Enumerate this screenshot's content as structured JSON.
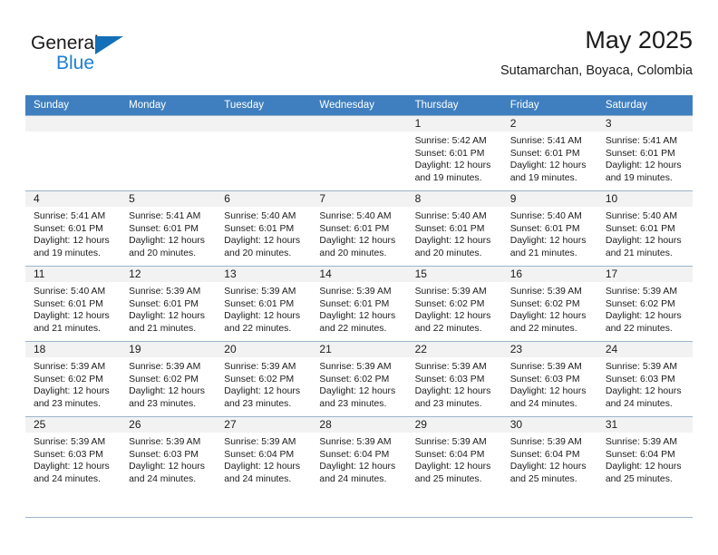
{
  "brand": {
    "name_part1": "General",
    "name_part2": "Blue",
    "color_primary": "#136fb7",
    "color_secondary": "#1b7fd4"
  },
  "header": {
    "title": "May 2025",
    "subtitle": "Sutamarchan, Boyaca, Colombia"
  },
  "calendar": {
    "header_bg": "#3f7fbf",
    "daynum_bg": "#f2f2f2",
    "grid_line": "#9cb4cc",
    "weekday_headers": [
      "Sunday",
      "Monday",
      "Tuesday",
      "Wednesday",
      "Thursday",
      "Friday",
      "Saturday"
    ],
    "labels": {
      "sunrise_prefix": "Sunrise:",
      "sunset_prefix": "Sunset:",
      "daylight_prefix": "Daylight:"
    },
    "weeks": [
      [
        {
          "empty": true
        },
        {
          "empty": true
        },
        {
          "empty": true
        },
        {
          "empty": true
        },
        {
          "day": "1",
          "sunrise": "Sunrise: 5:42 AM",
          "sunset": "Sunset: 6:01 PM",
          "daylight_line1": "Daylight: 12 hours",
          "daylight_line2": "and 19 minutes."
        },
        {
          "day": "2",
          "sunrise": "Sunrise: 5:41 AM",
          "sunset": "Sunset: 6:01 PM",
          "daylight_line1": "Daylight: 12 hours",
          "daylight_line2": "and 19 minutes."
        },
        {
          "day": "3",
          "sunrise": "Sunrise: 5:41 AM",
          "sunset": "Sunset: 6:01 PM",
          "daylight_line1": "Daylight: 12 hours",
          "daylight_line2": "and 19 minutes."
        }
      ],
      [
        {
          "day": "4",
          "sunrise": "Sunrise: 5:41 AM",
          "sunset": "Sunset: 6:01 PM",
          "daylight_line1": "Daylight: 12 hours",
          "daylight_line2": "and 19 minutes."
        },
        {
          "day": "5",
          "sunrise": "Sunrise: 5:41 AM",
          "sunset": "Sunset: 6:01 PM",
          "daylight_line1": "Daylight: 12 hours",
          "daylight_line2": "and 20 minutes."
        },
        {
          "day": "6",
          "sunrise": "Sunrise: 5:40 AM",
          "sunset": "Sunset: 6:01 PM",
          "daylight_line1": "Daylight: 12 hours",
          "daylight_line2": "and 20 minutes."
        },
        {
          "day": "7",
          "sunrise": "Sunrise: 5:40 AM",
          "sunset": "Sunset: 6:01 PM",
          "daylight_line1": "Daylight: 12 hours",
          "daylight_line2": "and 20 minutes."
        },
        {
          "day": "8",
          "sunrise": "Sunrise: 5:40 AM",
          "sunset": "Sunset: 6:01 PM",
          "daylight_line1": "Daylight: 12 hours",
          "daylight_line2": "and 20 minutes."
        },
        {
          "day": "9",
          "sunrise": "Sunrise: 5:40 AM",
          "sunset": "Sunset: 6:01 PM",
          "daylight_line1": "Daylight: 12 hours",
          "daylight_line2": "and 21 minutes."
        },
        {
          "day": "10",
          "sunrise": "Sunrise: 5:40 AM",
          "sunset": "Sunset: 6:01 PM",
          "daylight_line1": "Daylight: 12 hours",
          "daylight_line2": "and 21 minutes."
        }
      ],
      [
        {
          "day": "11",
          "sunrise": "Sunrise: 5:40 AM",
          "sunset": "Sunset: 6:01 PM",
          "daylight_line1": "Daylight: 12 hours",
          "daylight_line2": "and 21 minutes."
        },
        {
          "day": "12",
          "sunrise": "Sunrise: 5:39 AM",
          "sunset": "Sunset: 6:01 PM",
          "daylight_line1": "Daylight: 12 hours",
          "daylight_line2": "and 21 minutes."
        },
        {
          "day": "13",
          "sunrise": "Sunrise: 5:39 AM",
          "sunset": "Sunset: 6:01 PM",
          "daylight_line1": "Daylight: 12 hours",
          "daylight_line2": "and 22 minutes."
        },
        {
          "day": "14",
          "sunrise": "Sunrise: 5:39 AM",
          "sunset": "Sunset: 6:01 PM",
          "daylight_line1": "Daylight: 12 hours",
          "daylight_line2": "and 22 minutes."
        },
        {
          "day": "15",
          "sunrise": "Sunrise: 5:39 AM",
          "sunset": "Sunset: 6:02 PM",
          "daylight_line1": "Daylight: 12 hours",
          "daylight_line2": "and 22 minutes."
        },
        {
          "day": "16",
          "sunrise": "Sunrise: 5:39 AM",
          "sunset": "Sunset: 6:02 PM",
          "daylight_line1": "Daylight: 12 hours",
          "daylight_line2": "and 22 minutes."
        },
        {
          "day": "17",
          "sunrise": "Sunrise: 5:39 AM",
          "sunset": "Sunset: 6:02 PM",
          "daylight_line1": "Daylight: 12 hours",
          "daylight_line2": "and 22 minutes."
        }
      ],
      [
        {
          "day": "18",
          "sunrise": "Sunrise: 5:39 AM",
          "sunset": "Sunset: 6:02 PM",
          "daylight_line1": "Daylight: 12 hours",
          "daylight_line2": "and 23 minutes."
        },
        {
          "day": "19",
          "sunrise": "Sunrise: 5:39 AM",
          "sunset": "Sunset: 6:02 PM",
          "daylight_line1": "Daylight: 12 hours",
          "daylight_line2": "and 23 minutes."
        },
        {
          "day": "20",
          "sunrise": "Sunrise: 5:39 AM",
          "sunset": "Sunset: 6:02 PM",
          "daylight_line1": "Daylight: 12 hours",
          "daylight_line2": "and 23 minutes."
        },
        {
          "day": "21",
          "sunrise": "Sunrise: 5:39 AM",
          "sunset": "Sunset: 6:02 PM",
          "daylight_line1": "Daylight: 12 hours",
          "daylight_line2": "and 23 minutes."
        },
        {
          "day": "22",
          "sunrise": "Sunrise: 5:39 AM",
          "sunset": "Sunset: 6:03 PM",
          "daylight_line1": "Daylight: 12 hours",
          "daylight_line2": "and 23 minutes."
        },
        {
          "day": "23",
          "sunrise": "Sunrise: 5:39 AM",
          "sunset": "Sunset: 6:03 PM",
          "daylight_line1": "Daylight: 12 hours",
          "daylight_line2": "and 24 minutes."
        },
        {
          "day": "24",
          "sunrise": "Sunrise: 5:39 AM",
          "sunset": "Sunset: 6:03 PM",
          "daylight_line1": "Daylight: 12 hours",
          "daylight_line2": "and 24 minutes."
        }
      ],
      [
        {
          "day": "25",
          "sunrise": "Sunrise: 5:39 AM",
          "sunset": "Sunset: 6:03 PM",
          "daylight_line1": "Daylight: 12 hours",
          "daylight_line2": "and 24 minutes."
        },
        {
          "day": "26",
          "sunrise": "Sunrise: 5:39 AM",
          "sunset": "Sunset: 6:03 PM",
          "daylight_line1": "Daylight: 12 hours",
          "daylight_line2": "and 24 minutes."
        },
        {
          "day": "27",
          "sunrise": "Sunrise: 5:39 AM",
          "sunset": "Sunset: 6:04 PM",
          "daylight_line1": "Daylight: 12 hours",
          "daylight_line2": "and 24 minutes."
        },
        {
          "day": "28",
          "sunrise": "Sunrise: 5:39 AM",
          "sunset": "Sunset: 6:04 PM",
          "daylight_line1": "Daylight: 12 hours",
          "daylight_line2": "and 24 minutes."
        },
        {
          "day": "29",
          "sunrise": "Sunrise: 5:39 AM",
          "sunset": "Sunset: 6:04 PM",
          "daylight_line1": "Daylight: 12 hours",
          "daylight_line2": "and 25 minutes."
        },
        {
          "day": "30",
          "sunrise": "Sunrise: 5:39 AM",
          "sunset": "Sunset: 6:04 PM",
          "daylight_line1": "Daylight: 12 hours",
          "daylight_line2": "and 25 minutes."
        },
        {
          "day": "31",
          "sunrise": "Sunrise: 5:39 AM",
          "sunset": "Sunset: 6:04 PM",
          "daylight_line1": "Daylight: 12 hours",
          "daylight_line2": "and 25 minutes."
        }
      ]
    ]
  }
}
